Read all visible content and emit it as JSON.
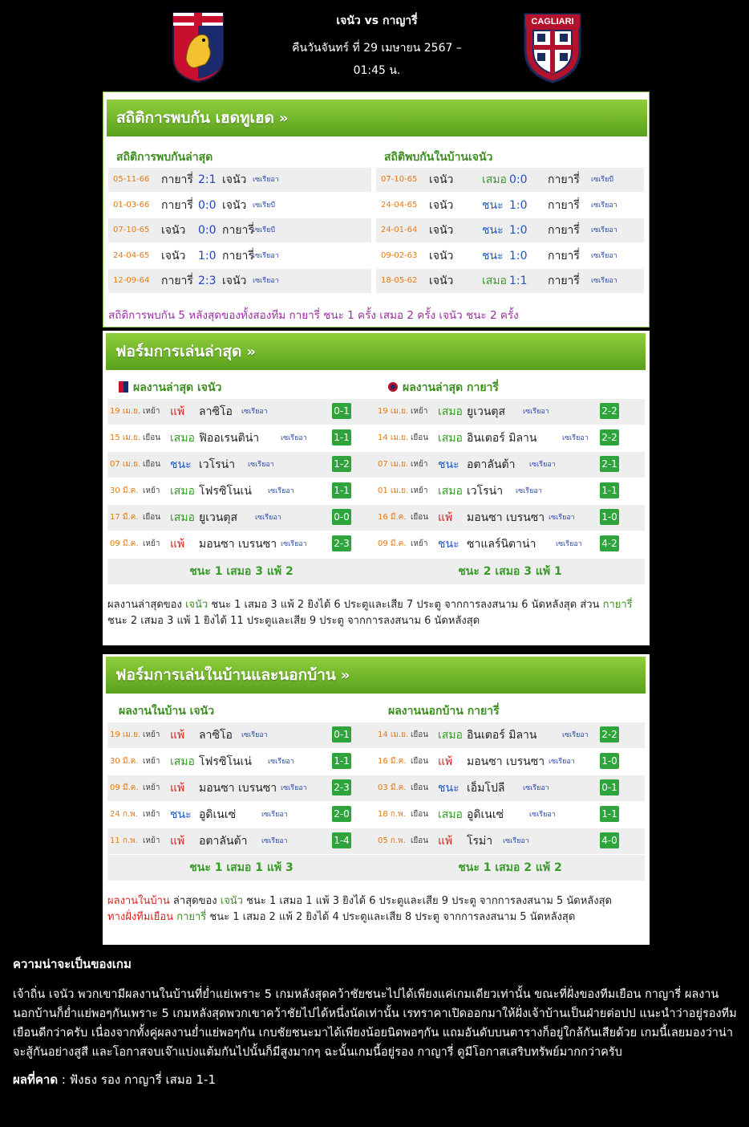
{
  "header": {
    "title": "เจนัว vs กาญารี่",
    "datetime_line1": "คืนวันจันทร์ ที่ 29 เมษายน 2567 –",
    "datetime_line2": "01:45 น.",
    "home_logo_text": "",
    "away_logo_text": "CAGLIARI"
  },
  "h2h": {
    "heading": "สถิติการพบกัน เฮดทูเฮด",
    "arrow": "»",
    "left_title": "สถิติการพบกันล่าสุด",
    "right_title": "สถิติพบกันในบ้านเจนัว",
    "left_rows": [
      {
        "date": "05-11-66",
        "home": "กายารี่",
        "score": "2:1",
        "away": "เจนัว",
        "league": "เซเรียอา",
        "score_blue": true
      },
      {
        "date": "01-03-66",
        "home": "กายารี่",
        "score": "0:0",
        "away": "เจนัว",
        "league": "เซเรียบี",
        "score_blue": true
      },
      {
        "date": "07-10-65",
        "home": "เจนัว",
        "score": "0:0",
        "away": "กายารี่",
        "league": "เซเรียบี",
        "score_blue": true
      },
      {
        "date": "24-04-65",
        "home": "เจนัว",
        "score": "1:0",
        "away": "กายารี่",
        "league": "เซเรียอา",
        "score_blue": true
      },
      {
        "date": "12-09-64",
        "home": "กายารี่",
        "score": "2:3",
        "away": "เจนัว",
        "league": "เซเรียอา",
        "score_blue": true
      }
    ],
    "right_rows": [
      {
        "date": "07-10-65",
        "home": "เจนัว",
        "result": "เสมอ",
        "score": "0:0",
        "away": "กายารี่",
        "league": "เซเรียบี"
      },
      {
        "date": "24-04-65",
        "home": "เจนัว",
        "result": "ชนะ",
        "score": "1:0",
        "away": "กายารี่",
        "league": "เซเรียอา"
      },
      {
        "date": "24-01-64",
        "home": "เจนัว",
        "result": "ชนะ",
        "score": "1:0",
        "away": "กายารี่",
        "league": "เซเรียอา"
      },
      {
        "date": "09-02-63",
        "home": "เจนัว",
        "result": "ชนะ",
        "score": "1:0",
        "away": "กายารี่",
        "league": "เซเรียอา"
      },
      {
        "date": "18-05-62",
        "home": "เจนัว",
        "result": "เสมอ",
        "score": "1:1",
        "away": "กายารี่",
        "league": "เซเรียอา"
      }
    ],
    "summary": "สถิติการพบกัน 5 หลังสุดของทั้งสองทีม กายารี่ ชนะ 1 ครั้ง เสมอ 2 ครั้ง เจนัว ชนะ 2 ครั้ง"
  },
  "form": {
    "heading": "ฟอร์มการเล่นล่าสุด",
    "arrow": "»",
    "left_title": "ผลงานล่าสุด เจนัว",
    "right_title": "ผลงานล่าสุด กายารี่",
    "left_rows": [
      {
        "date": "19 เม.ย.",
        "ha": "เหย้า",
        "res": "แพ้",
        "team": "ลาซิโอ",
        "league": "เซเรียอา",
        "score": "0-1"
      },
      {
        "date": "15 เม.ย.",
        "ha": "เยือน",
        "res": "เสมอ",
        "team": "ฟิออเรนติน่า",
        "league": "เซเรียอา",
        "score": "1-1"
      },
      {
        "date": "07 เม.ย.",
        "ha": "เยือน",
        "res": "ชนะ",
        "team": "เวโรน่า",
        "league": "เซเรียอา",
        "score": "1-2"
      },
      {
        "date": "30 มี.ค.",
        "ha": "เหย้า",
        "res": "เสมอ",
        "team": "โฟรซิโนเน่",
        "league": "เซเรียอา",
        "score": "1-1"
      },
      {
        "date": "17 มี.ค.",
        "ha": "เยือน",
        "res": "เสมอ",
        "team": "ยูเวนตุส",
        "league": "เซเรียอา",
        "score": "0-0"
      },
      {
        "date": "09 มี.ค.",
        "ha": "เหย้า",
        "res": "แพ้",
        "team": "มอนซา เบรนซา",
        "league": "เซเรียอา",
        "score": "2-3"
      }
    ],
    "right_rows": [
      {
        "date": "19 เม.ย.",
        "ha": "เหย้า",
        "res": "เสมอ",
        "team": "ยูเวนตุส",
        "league": "เซเรียอา",
        "score": "2-2"
      },
      {
        "date": "14 เม.ย.",
        "ha": "เยือน",
        "res": "เสมอ",
        "team": "อินเตอร์ มิลาน",
        "league": "เซเรียอา",
        "score": "2-2"
      },
      {
        "date": "07 เม.ย.",
        "ha": "เหย้า",
        "res": "ชนะ",
        "team": "อตาลันต้า",
        "league": "เซเรียอา",
        "score": "2-1"
      },
      {
        "date": "01 เม.ย.",
        "ha": "เหย้า",
        "res": "เสมอ",
        "team": "เวโรน่า",
        "league": "เซเรียอา",
        "score": "1-1"
      },
      {
        "date": "16 มี.ค.",
        "ha": "เยือน",
        "res": "แพ้",
        "team": "มอนซา เบรนซา",
        "league": "เซเรียอา",
        "score": "1-0"
      },
      {
        "date": "09 มี.ค.",
        "ha": "เหย้า",
        "res": "ชนะ",
        "team": "ซาแลร์นิตาน่า",
        "league": "เซเรียอา",
        "score": "4-2"
      }
    ],
    "left_summary": "ชนะ 1 เสมอ 3 แพ้ 2",
    "right_summary": "ชนะ 2 เสมอ 3 แพ้ 1",
    "note_parts": [
      "ผลงานล่าสุดของ ",
      "เจนัว",
      " ชนะ 1 เสมอ 3 แพ้ 2 ยิงได้ 6 ประตูและเสีย 7 ประตู จากการลงสนาม 6 นัดหลังสุด ส่วน ",
      "กายารี่",
      " ชนะ 2 เสมอ 3 แพ้ 1 ยิงได้ 11 ประตูและเสีย 9 ประตู จากการลงสนาม 6 นัดหลังสุด"
    ]
  },
  "homeaway": {
    "heading": "ฟอร์มการเล่นในบ้านและนอกบ้าน",
    "arrow": "»",
    "left_title": "ผลงานในบ้าน เจนัว",
    "right_title": "ผลงานนอกบ้าน กายารี่",
    "left_rows": [
      {
        "date": "19 เม.ย.",
        "ha": "เหย้า",
        "res": "แพ้",
        "team": "ลาซิโอ",
        "league": "เซเรียอา",
        "score": "0-1"
      },
      {
        "date": "30 มี.ค.",
        "ha": "เหย้า",
        "res": "เสมอ",
        "team": "โฟรซิโนเน่",
        "league": "เซเรียอา",
        "score": "1-1"
      },
      {
        "date": "09 มี.ค.",
        "ha": "เหย้า",
        "res": "แพ้",
        "team": "มอนซา เบรนซา",
        "league": "เซเรียอา",
        "score": "2-3"
      },
      {
        "date": "24 ก.พ.",
        "ha": "เหย้า",
        "res": "ชนะ",
        "team": "อูดิเนเซ่",
        "league": "เซเรียอา",
        "score": "2-0"
      },
      {
        "date": "11 ก.พ.",
        "ha": "เหย้า",
        "res": "แพ้",
        "team": "อตาลันต้า",
        "league": "เซเรียอา",
        "score": "1-4"
      }
    ],
    "right_rows": [
      {
        "date": "14 เม.ย.",
        "ha": "เยือน",
        "res": "เสมอ",
        "team": "อินเตอร์ มิลาน",
        "league": "เซเรียอา",
        "score": "2-2"
      },
      {
        "date": "16 มี.ค.",
        "ha": "เยือน",
        "res": "แพ้",
        "team": "มอนซา เบรนซา",
        "league": "เซเรียอา",
        "score": "1-0"
      },
      {
        "date": "03 มี.ค.",
        "ha": "เยือน",
        "res": "ชนะ",
        "team": "เอ็มโปลี",
        "league": "เซเรียอา",
        "score": "0-1"
      },
      {
        "date": "18 ก.พ.",
        "ha": "เยือน",
        "res": "เสมอ",
        "team": "อูดิเนเซ่",
        "league": "เซเรียอา",
        "score": "1-1"
      },
      {
        "date": "05 ก.พ.",
        "ha": "เยือน",
        "res": "แพ้",
        "team": "โรม่า",
        "league": "เซเรียอา",
        "score": "4-0"
      }
    ],
    "left_summary": "ชนะ 1 เสมอ 1 แพ้ 3",
    "right_summary": "ชนะ 1 เสมอ 2 แพ้ 2",
    "note1_parts": [
      "ผลงานในบ้าน",
      " ล่าสุดของ ",
      "เจนัว",
      " ชนะ 1 เสมอ 1 แพ้ 3 ยิงได้ 6 ประตูและเสีย 9 ประตู จากการลงสนาม 5 นัดหลังสุด"
    ],
    "note2_parts": [
      "ทางฝั่งทีมเยือน ",
      "กายารี่",
      " ชนะ 1 เสมอ 2 แพ้ 2 ยิงได้ 4 ประตูและเสีย 8 ประตู จากการลงสนาม 5 นัดหลังสุด"
    ]
  },
  "article": {
    "heading": "ความน่าจะเป็นของเกม",
    "body": "เจ้าถิ่น เจนัว พวกเขามีผลงานในบ้านที่ย่ำแย่เพราะ 5 เกมหลังสุดคว้าชัยชนะไปได้เพียงแค่เกมเดียวเท่านั้น ขณะที่ฝั่งของทีมเยือน กาญารี่ ผลงานนอกบ้านก็ย่ำแย่พอๆกันเพราะ 5 เกมหลังสุดพวกเขาคว้าชัยไปได้หนึ่งนัดเท่านั้น เรทราคาเปิดออกมาให้ฝั่งเจ้าบ้านเป็นฝ่ายต่อปป แนะนำว่าอยู่รองทีมเยือนดีกว่าครับ เนื่องจากทั้งคู่ผลงานย่ำแย่พอๆกัน เกบชัยชนะมาได้เพียงน้อยนิดพอๆกัน แถมอันดับบนตารางก็อยู่ใกล้กันเสียด้วย เกมนี้เลยมองว่าน่าจะสู้กันอย่างสูสี และโอกาสจบเจ๊าแบ่งแต้มกันไปนั้นก็มีสูงมากๆ ฉะนั้นเกมนี้อยู่รอง กาญารี่ ดูมีโอกาสเสริบทรัพย์มากกว่าครับ",
    "prediction_label": "ผลที่คาด",
    "prediction_value": " : ฟังธง รอง กาญารี่ เสมอ 1-1"
  },
  "colors": {
    "green_band": "#6cb52a",
    "badge": "#2fa43c",
    "win": "#1f56c0",
    "draw": "#3a9a2a",
    "lose": "#e02020",
    "date": "#e07a17"
  }
}
